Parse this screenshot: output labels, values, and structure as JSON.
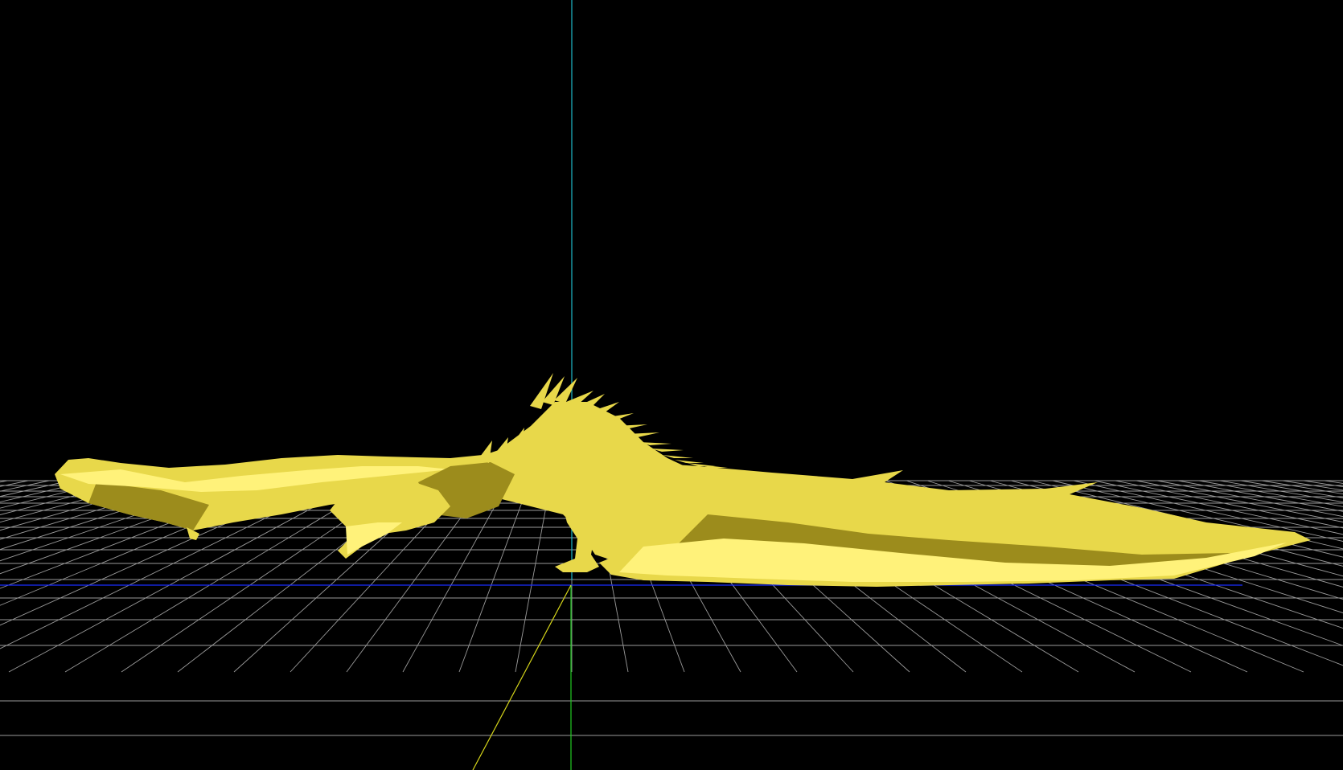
{
  "viewport": {
    "background": "#000000",
    "grid_color": "#9a9a9a",
    "model_color": "#e8d84a",
    "model_highlight": "#fff27a",
    "model_shadow": "#9c8c1c",
    "axes": {
      "x_color": "#1a2cff",
      "y_color": "#22cc22",
      "z_color": "#d6d61a",
      "up_color": "#1fb8c8"
    }
  }
}
